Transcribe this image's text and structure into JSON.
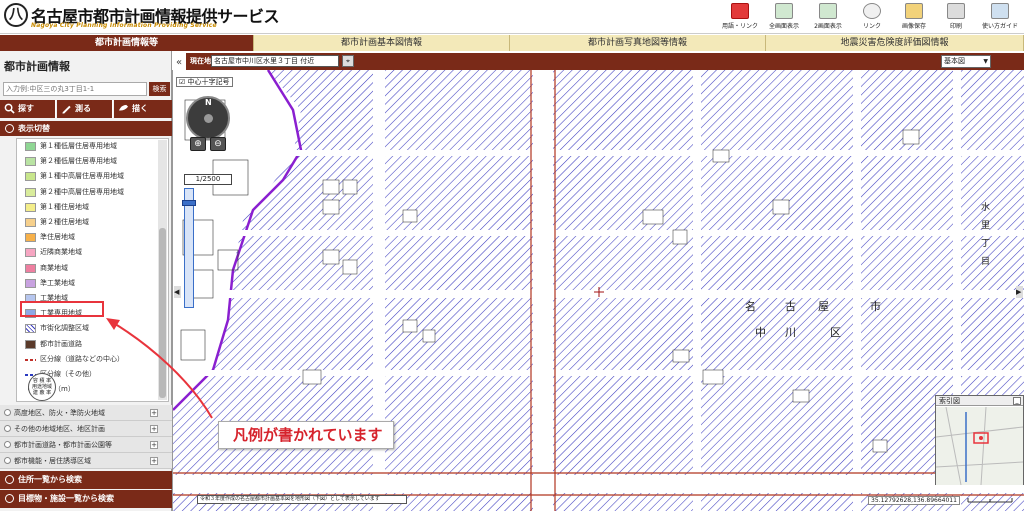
{
  "header": {
    "logo_mark": "八",
    "title": "名古屋市都市計画情報提供サービス",
    "subtitle": "Nagoya City Planning Information Providing Service",
    "tools": [
      {
        "name": "help-link",
        "label": "用語・リンク"
      },
      {
        "name": "fullscreen",
        "label": "全画面表示"
      },
      {
        "name": "dual-screen",
        "label": "2画面表示"
      },
      {
        "name": "link",
        "label": "リンク"
      },
      {
        "name": "save-image",
        "label": "画像保存"
      },
      {
        "name": "print",
        "label": "印刷"
      },
      {
        "name": "guide",
        "label": "使い方ガイド"
      }
    ]
  },
  "tabs": [
    "都市計画情報等",
    "都市計画基本図情報",
    "都市計画写真地図等情報",
    "地震災害危険度評価図情報"
  ],
  "sidebar": {
    "title": "都市計画情報",
    "search_placeholder": "入力例:中区三の丸3丁目1-1",
    "search_button": "検索",
    "actions": [
      "探す",
      "測る",
      "描く"
    ],
    "section": "表示切替",
    "legend": [
      {
        "label": "第１種低層住居専用地域",
        "color": "#8fd694"
      },
      {
        "label": "第２種低層住居専用地域",
        "color": "#b9e3a3"
      },
      {
        "label": "第１種中高層住居専用地域",
        "color": "#c8e68c"
      },
      {
        "label": "第２種中高層住居専用地域",
        "color": "#d9ec9c"
      },
      {
        "label": "第１種住居地域",
        "color": "#f4ee8a"
      },
      {
        "label": "第２種住居地域",
        "color": "#f6d08c"
      },
      {
        "label": "準住居地域",
        "color": "#f7b14a"
      },
      {
        "label": "近隣商業地域",
        "color": "#f6a6c2"
      },
      {
        "label": "商業地域",
        "color": "#ee7fa0"
      },
      {
        "label": "準工業地域",
        "color": "#c8a2e0"
      },
      {
        "label": "工業地域",
        "color": "#b6c6ee"
      },
      {
        "label": "工業専用地域",
        "color": "#8fa8e6"
      },
      {
        "label": "市街化調整区域",
        "color": "hatch"
      },
      {
        "label": "都市計画道路",
        "color": "#5a3a2a"
      },
      {
        "label": "区分線（道路などの中心）",
        "color": "dash-red"
      },
      {
        "label": "区分線（その他）",
        "color": "dash-blue"
      },
      {
        "label": "距離（m）",
        "color": "dot"
      }
    ],
    "sign_text": [
      "容 積 率",
      "用途地域",
      "建 蔽 率"
    ],
    "accordions": [
      "高度地区、防火・準防火地域",
      "その他の地域地区、地区計画",
      "都市計画道路・都市計画公園等",
      "都市機能・居住誘導区域"
    ],
    "bottom_buttons": [
      "住所一覧から検索",
      "目標物・施設一覧から検索"
    ]
  },
  "map_toolbar": {
    "location_label": "現在地",
    "location_value": "名古屋市中川区水里３丁目 付近",
    "basemap": "基本図"
  },
  "map": {
    "crosshair_label": "中心十字記号",
    "compass_label": "N",
    "scale": "1/2500",
    "labels": [
      "名",
      "古",
      "屋",
      "市",
      "中",
      "川",
      "区",
      "水",
      "里",
      "丁",
      "目"
    ],
    "notice": "令和３年度作成の名古屋都市計画基本図を地形図（下図）として表示しています",
    "coords": "35.12792628,136.89664011",
    "index_map_title": "索引図"
  },
  "annotation": {
    "callout_text": "凡例が書かれています",
    "color": "#e8343c"
  },
  "colors": {
    "brand": "#7a2a18",
    "tab_bg": "#f3e9b9",
    "hatch": "#3d3dc0",
    "boundary": "#8a1fd0"
  }
}
